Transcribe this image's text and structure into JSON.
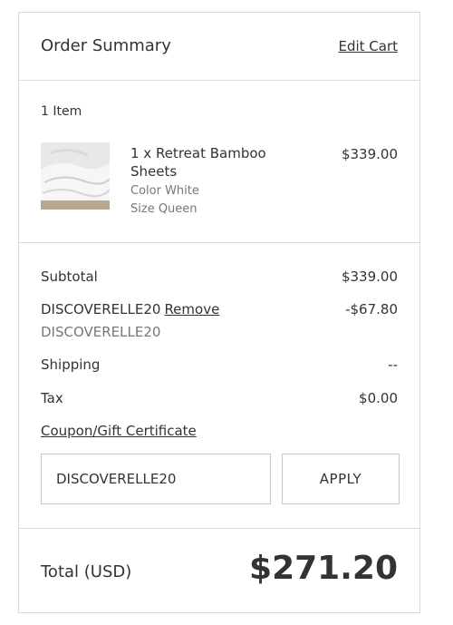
{
  "header": {
    "title": "Order Summary",
    "edit_cart": "Edit Cart"
  },
  "items": {
    "count": "1 Item",
    "list": [
      {
        "name": "1 x Retreat Bamboo Sheets",
        "price": "$339.00",
        "color": "Color White",
        "size": "Size Queen"
      }
    ]
  },
  "summary": {
    "subtotal_label": "Subtotal",
    "subtotal_value": "$339.00",
    "discount_code": "DISCOVERELLE20",
    "remove_label": "Remove",
    "discount_value": "-$67.80",
    "discount_subtext": "DISCOVERELLE20",
    "shipping_label": "Shipping",
    "shipping_value": "--",
    "tax_label": "Tax",
    "tax_value": "$0.00",
    "coupon_link": "Coupon/Gift Certificate",
    "coupon_input_value": "DISCOVERELLE20",
    "apply_label": "APPLY"
  },
  "total": {
    "label": "Total (USD)",
    "value": "$271.20"
  }
}
